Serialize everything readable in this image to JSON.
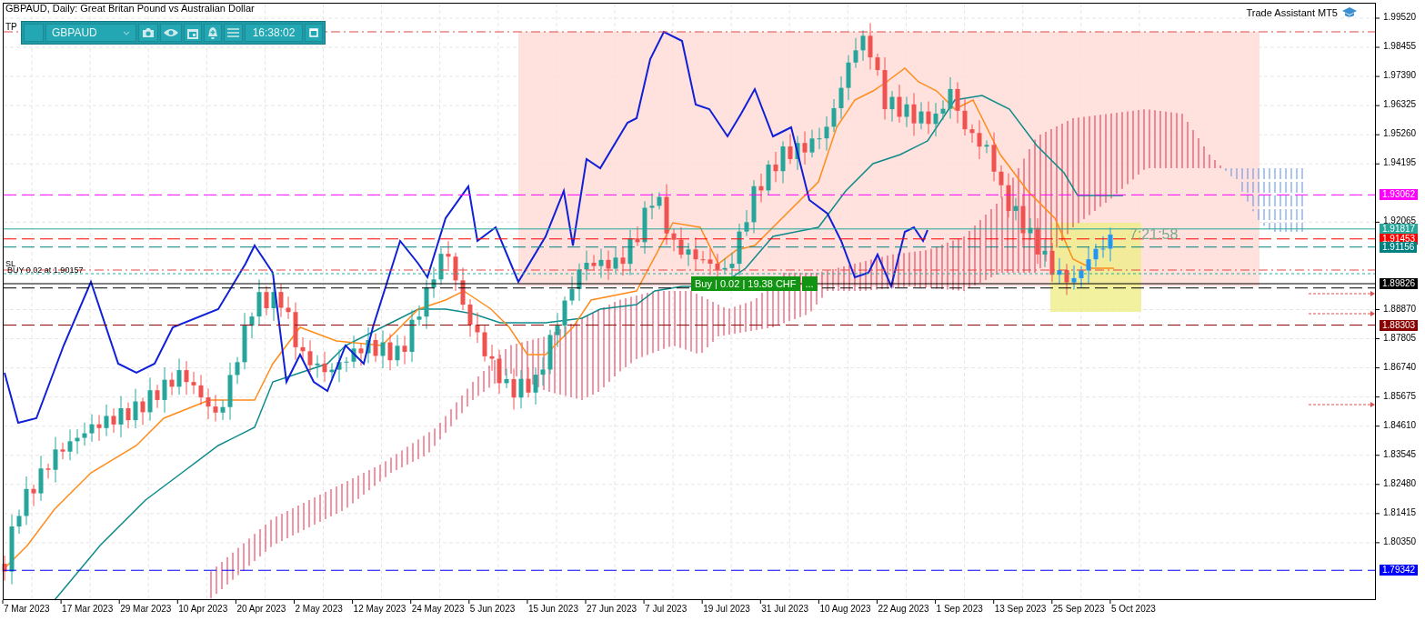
{
  "title": "GBPAUD, Daily:  Great Britan Pound vs Australian Dollar",
  "toolbar": {
    "symbol": "GBPAUD",
    "time": "16:38:02"
  },
  "tp_label": "TP",
  "sl_label": "SL",
  "order_label": "BUY 0.02 at 1.90157",
  "trade_assistant": "Trade Assistant MT5",
  "position": {
    "label": "Buy | 0.02 | 19.38 CHF",
    "more": "..."
  },
  "countdown": "7:21:58",
  "price_ticks": [
    "1.99520",
    "1.98455",
    "1.97390",
    "1.96325",
    "1.95260",
    "1.94195",
    "1.92065",
    "1.88870",
    "1.87805",
    "1.86740",
    "1.85675",
    "1.84610",
    "1.83545",
    "1.82480",
    "1.81415",
    "1.80350"
  ],
  "price_levels": [
    {
      "value": "1.93062",
      "color": "#ff00ff"
    },
    {
      "value": "1.91817",
      "color": "#26a69a"
    },
    {
      "value": "1.91453",
      "color": "#ff0000"
    },
    {
      "value": "1.91156",
      "color": "#008080"
    },
    {
      "value": "1.89826",
      "color": "#000000"
    },
    {
      "value": "1.88303",
      "color": "#8b0000"
    },
    {
      "value": "1.79342",
      "color": "#0000ff"
    }
  ],
  "dates": [
    "7 Mar 2023",
    "17 Mar 2023",
    "29 Mar 2023",
    "10 Apr 2023",
    "20 Apr 2023",
    "2 May 2023",
    "12 May 2023",
    "24 May 2023",
    "5 Jun 2023",
    "15 Jun 2023",
    "27 Jun 2023",
    "7 Jul 2023",
    "19 Jul 2023",
    "31 Jul 2023",
    "10 Aug 2023",
    "22 Aug 2023",
    "1 Sep 2023",
    "13 Sep 2023",
    "25 Sep 2023",
    "5 Oct 2023"
  ]
}
